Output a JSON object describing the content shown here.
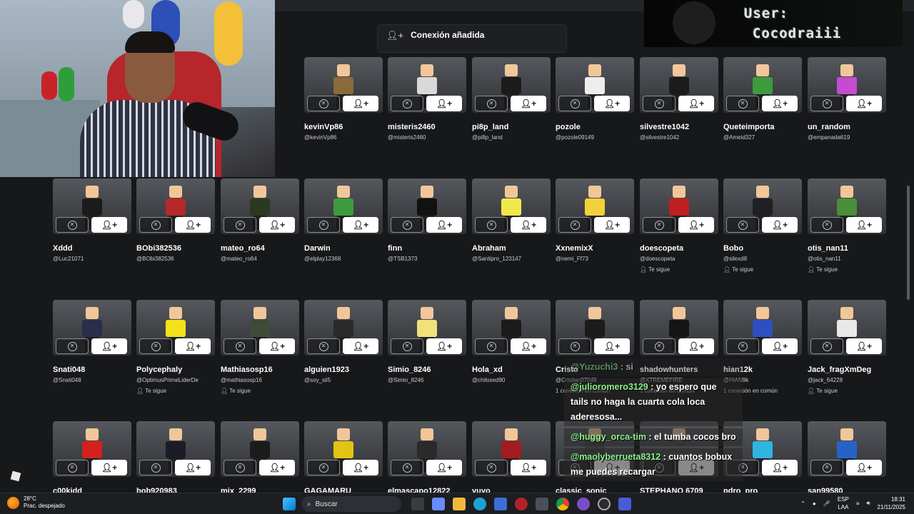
{
  "toast": {
    "icon": "person-added-icon",
    "text": "Conexión añadida"
  },
  "overlay": {
    "line1": "User:",
    "line2": "Cocodraiii"
  },
  "cards": [
    {
      "name": "kevinVp86",
      "handle": "@kevinVp86",
      "follow": "",
      "skin": "#8a6a3a"
    },
    {
      "name": "misteris2460",
      "handle": "@misteris2460",
      "follow": "",
      "skin": "#d9d9d9"
    },
    {
      "name": "pi8p_land",
      "handle": "@pi8p_land",
      "follow": "",
      "skin": "#1b1b1b"
    },
    {
      "name": "pozole",
      "handle": "@pozole09149",
      "follow": "",
      "skin": "#eeeeee"
    },
    {
      "name": "silvestre1042",
      "handle": "@silvestre1042",
      "follow": "",
      "skin": "#1b1b1b"
    },
    {
      "name": "Queteimporta",
      "handle": "@Ameid327",
      "follow": "",
      "skin": "#3d9b3d"
    },
    {
      "name": "un_random",
      "handle": "@empanada619",
      "follow": "",
      "skin": "#c74bd1"
    },
    {
      "name": "Xddd",
      "handle": "@Luc21071",
      "follow": "",
      "skin": "#1b1b1b"
    },
    {
      "name": "BObi382536",
      "handle": "@BObi382536",
      "follow": "",
      "skin": "#b5292b"
    },
    {
      "name": "mateo_ro64",
      "handle": "@mateo_ro64",
      "follow": "",
      "skin": "#2b3a1e"
    },
    {
      "name": "Darwin",
      "handle": "@elplay12368",
      "follow": "",
      "skin": "#3e9b3c"
    },
    {
      "name": "finn",
      "handle": "@TSB1373",
      "follow": "",
      "skin": "#111111"
    },
    {
      "name": "Abraham",
      "handle": "@Santipro_123147",
      "follow": "",
      "skin": "#f2e84b"
    },
    {
      "name": "XxnemixX",
      "handle": "@nemi_Ff73",
      "follow": "",
      "skin": "#f2d13a"
    },
    {
      "name": "doescopeta",
      "handle": "@doescopeta",
      "follow": "Te sigue",
      "skin": "#c11f21"
    },
    {
      "name": "Bobo",
      "handle": "@silexd8",
      "follow": "Te sigue",
      "skin": "#1f1f24"
    },
    {
      "name": "otis_nan11",
      "handle": "@otis_nan11",
      "follow": "Te sigue",
      "skin": "#4a8d3a"
    },
    {
      "name": "Snati048",
      "handle": "@Snati048",
      "follow": "",
      "skin": "#2b2e4a"
    },
    {
      "name": "Polycephaly",
      "handle": "@OptimusPrimeLiderDe",
      "follow": "Te sigue",
      "skin": "#f3e21a"
    },
    {
      "name": "Mathiasosp16",
      "handle": "@mathiasosp16",
      "follow": "Te sigue",
      "skin": "#3e4a3a"
    },
    {
      "name": "alguien1923",
      "handle": "@soy_sii5",
      "follow": "",
      "skin": "#2a2a2a"
    },
    {
      "name": "Simio_8246",
      "handle": "@Simio_8246",
      "follow": "",
      "skin": "#f1e17a"
    },
    {
      "name": "Hola_xd",
      "handle": "@chilosed90",
      "follow": "",
      "skin": "#1b1b1b"
    },
    {
      "name": "Cristo",
      "handle": "@Cristian07048",
      "follow": "1 conexión en común",
      "skin": "#1b1b1b"
    },
    {
      "name": "shadowhunters",
      "handle": "@XTREMEFIRE",
      "follow": "1 conexión en común",
      "skin": "#151515"
    },
    {
      "name": "hian12k",
      "handle": "@HiAN9k",
      "follow": "1 conexión en común",
      "skin": "#2d4fc0"
    },
    {
      "name": "Jack_fragXmDeg",
      "handle": "@jack_64228",
      "follow": "Te sigue",
      "skin": "#e9e9e9"
    },
    {
      "name": "c00kidd",
      "handle": "",
      "follow": "",
      "skin": "#d4201f"
    },
    {
      "name": "bob920983",
      "handle": "",
      "follow": "",
      "skin": "#1c1c28"
    },
    {
      "name": "mix_2299",
      "handle": "",
      "follow": "",
      "skin": "#1b1b1b"
    },
    {
      "name": "GAGAMARU",
      "handle": "",
      "follow": "",
      "skin": "#e1c515"
    },
    {
      "name": "elmascapo12822",
      "handle": "",
      "follow": "",
      "skin": "#2a2a2a"
    },
    {
      "name": "yuyo",
      "handle": "",
      "follow": "",
      "skin": "#a31c1f"
    },
    {
      "name": "classic_sonic",
      "handle": "",
      "follow": "",
      "skin": "#3a3a3a"
    },
    {
      "name": "STEPHANO 6709",
      "handle": "",
      "follow": "",
      "skin": "#444444"
    },
    {
      "name": "pdro_pro",
      "handle": "",
      "follow": "",
      "skin": "#2fb5e0"
    },
    {
      "name": "san99580",
      "handle": "",
      "follow": "",
      "skin": "#2563c9"
    }
  ],
  "chat": [
    {
      "user": "@Yuzuchi3",
      "text": " : si"
    },
    {
      "user": "@julioromero3129",
      "text": " : yo espero que tails no haga la cuarta cola loca aderesosa..."
    },
    {
      "user": "@huggy_orca-tim",
      "text": " : el tumba cocos bro"
    },
    {
      "user": "@maolyberrueta8312",
      "text": " : cuantos bobux me puedes recargar"
    }
  ],
  "taskbar": {
    "temp": "28°C",
    "weather": "Prac. despejado",
    "search_placeholder": "Buscar",
    "lang1": "ESP",
    "lang2": "LAA",
    "time": "18:31",
    "date": "21/11/2025"
  },
  "colors": {
    "background": "#17181a",
    "add_button": "#ffffff",
    "chat_user": "#8ef08e"
  }
}
